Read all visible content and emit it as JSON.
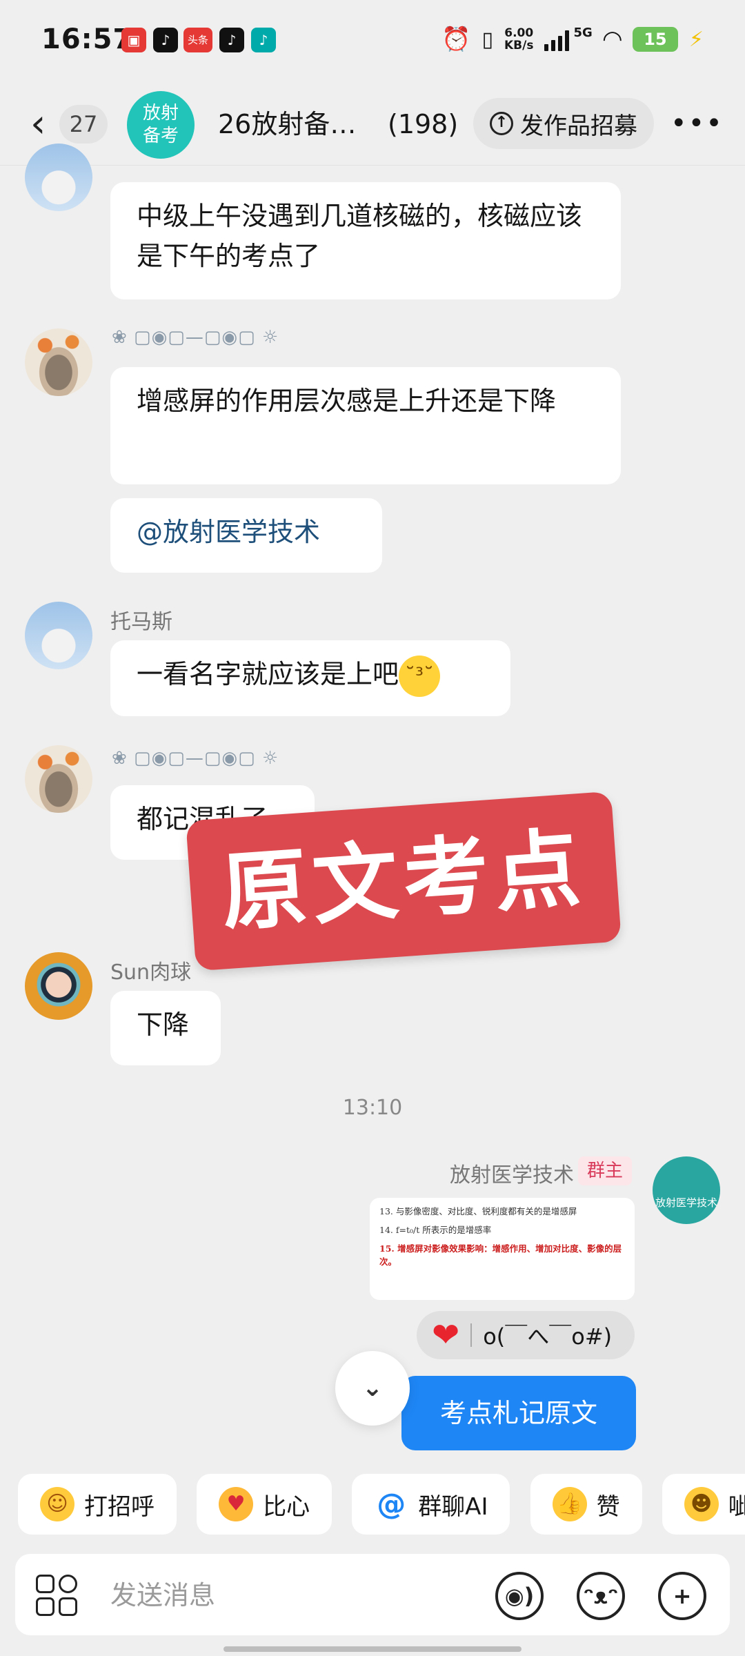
{
  "status_bar": {
    "time": "16:57",
    "notif_toutiao": "头条",
    "net_speed_value": "6.00",
    "net_speed_unit": "KB/s",
    "network": "5G",
    "battery": "15"
  },
  "header": {
    "back_count": "27",
    "group_avatar_line1": "放射",
    "group_avatar_line2": "备考",
    "group_name": "26放射备…",
    "member_count": "(198)",
    "recruit_button": "发作品招募"
  },
  "messages": [
    {
      "sender": "",
      "text": "中级上午没遇到几道核磁的，核磁应该是下午的考点了",
      "avatar": "person"
    },
    {
      "sender": "",
      "text": "增感屏的作用层次感是上升还是下降",
      "avatar": "cat"
    },
    {
      "sender": "",
      "text": "@放射医学技术",
      "avatar": "cat"
    },
    {
      "sender": "托马斯",
      "text": "一看名字就应该是上吧",
      "avatar": "person"
    },
    {
      "sender": "",
      "text": "都记混乱了",
      "avatar": "cat"
    },
    {
      "sender": "Sun肉球",
      "text": "下降",
      "avatar": "girl"
    }
  ],
  "sticker_text": "原文考点",
  "timestamp": "13:10",
  "owner": {
    "name": "放射医学技术",
    "tag": "群主",
    "avatar_text": "放射医学技术",
    "doc_lines": [
      "13. 与影像密度、对比度、锐利度都有关的是增感屏",
      "14. f=t₀/t 所表示的是增感率",
      "15. 增感屏对影像效果影响：增感作用、增加对比度、影像的层次。"
    ],
    "reaction_text": "o(￣へ￣o#)",
    "blue_message": "考点札记原文"
  },
  "quick_replies": [
    "打招呼",
    "比心",
    "群聊AI",
    "赞",
    "呲"
  ],
  "input": {
    "placeholder": "发送消息"
  },
  "colors": {
    "accent_blue": "#1e86f5",
    "group_teal": "#22c3b8",
    "sticker_red": "#dc4a4f",
    "owner_tag_red": "#d83a5a"
  }
}
